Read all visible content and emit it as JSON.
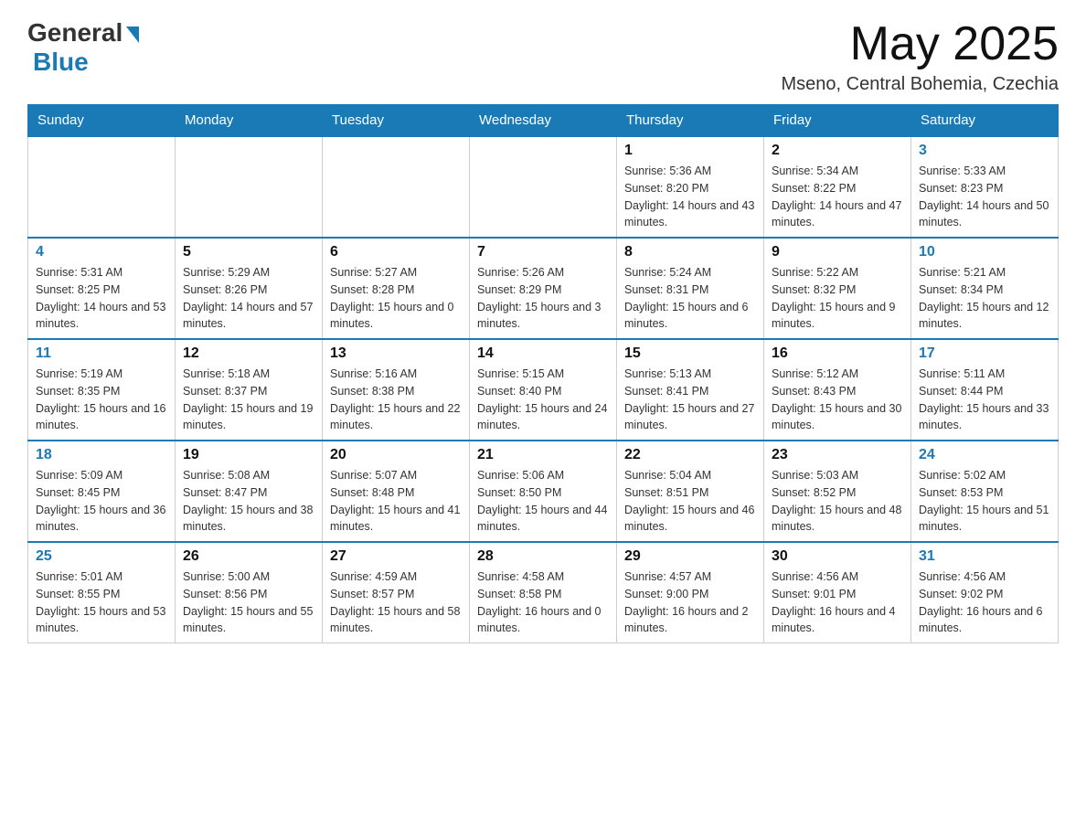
{
  "header": {
    "logo_general": "General",
    "logo_blue": "Blue",
    "month_title": "May 2025",
    "location": "Mseno, Central Bohemia, Czechia"
  },
  "weekdays": [
    "Sunday",
    "Monday",
    "Tuesday",
    "Wednesday",
    "Thursday",
    "Friday",
    "Saturday"
  ],
  "weeks": [
    [
      {
        "day": "",
        "info": ""
      },
      {
        "day": "",
        "info": ""
      },
      {
        "day": "",
        "info": ""
      },
      {
        "day": "",
        "info": ""
      },
      {
        "day": "1",
        "info": "Sunrise: 5:36 AM\nSunset: 8:20 PM\nDaylight: 14 hours and 43 minutes."
      },
      {
        "day": "2",
        "info": "Sunrise: 5:34 AM\nSunset: 8:22 PM\nDaylight: 14 hours and 47 minutes."
      },
      {
        "day": "3",
        "info": "Sunrise: 5:33 AM\nSunset: 8:23 PM\nDaylight: 14 hours and 50 minutes."
      }
    ],
    [
      {
        "day": "4",
        "info": "Sunrise: 5:31 AM\nSunset: 8:25 PM\nDaylight: 14 hours and 53 minutes."
      },
      {
        "day": "5",
        "info": "Sunrise: 5:29 AM\nSunset: 8:26 PM\nDaylight: 14 hours and 57 minutes."
      },
      {
        "day": "6",
        "info": "Sunrise: 5:27 AM\nSunset: 8:28 PM\nDaylight: 15 hours and 0 minutes."
      },
      {
        "day": "7",
        "info": "Sunrise: 5:26 AM\nSunset: 8:29 PM\nDaylight: 15 hours and 3 minutes."
      },
      {
        "day": "8",
        "info": "Sunrise: 5:24 AM\nSunset: 8:31 PM\nDaylight: 15 hours and 6 minutes."
      },
      {
        "day": "9",
        "info": "Sunrise: 5:22 AM\nSunset: 8:32 PM\nDaylight: 15 hours and 9 minutes."
      },
      {
        "day": "10",
        "info": "Sunrise: 5:21 AM\nSunset: 8:34 PM\nDaylight: 15 hours and 12 minutes."
      }
    ],
    [
      {
        "day": "11",
        "info": "Sunrise: 5:19 AM\nSunset: 8:35 PM\nDaylight: 15 hours and 16 minutes."
      },
      {
        "day": "12",
        "info": "Sunrise: 5:18 AM\nSunset: 8:37 PM\nDaylight: 15 hours and 19 minutes."
      },
      {
        "day": "13",
        "info": "Sunrise: 5:16 AM\nSunset: 8:38 PM\nDaylight: 15 hours and 22 minutes."
      },
      {
        "day": "14",
        "info": "Sunrise: 5:15 AM\nSunset: 8:40 PM\nDaylight: 15 hours and 24 minutes."
      },
      {
        "day": "15",
        "info": "Sunrise: 5:13 AM\nSunset: 8:41 PM\nDaylight: 15 hours and 27 minutes."
      },
      {
        "day": "16",
        "info": "Sunrise: 5:12 AM\nSunset: 8:43 PM\nDaylight: 15 hours and 30 minutes."
      },
      {
        "day": "17",
        "info": "Sunrise: 5:11 AM\nSunset: 8:44 PM\nDaylight: 15 hours and 33 minutes."
      }
    ],
    [
      {
        "day": "18",
        "info": "Sunrise: 5:09 AM\nSunset: 8:45 PM\nDaylight: 15 hours and 36 minutes."
      },
      {
        "day": "19",
        "info": "Sunrise: 5:08 AM\nSunset: 8:47 PM\nDaylight: 15 hours and 38 minutes."
      },
      {
        "day": "20",
        "info": "Sunrise: 5:07 AM\nSunset: 8:48 PM\nDaylight: 15 hours and 41 minutes."
      },
      {
        "day": "21",
        "info": "Sunrise: 5:06 AM\nSunset: 8:50 PM\nDaylight: 15 hours and 44 minutes."
      },
      {
        "day": "22",
        "info": "Sunrise: 5:04 AM\nSunset: 8:51 PM\nDaylight: 15 hours and 46 minutes."
      },
      {
        "day": "23",
        "info": "Sunrise: 5:03 AM\nSunset: 8:52 PM\nDaylight: 15 hours and 48 minutes."
      },
      {
        "day": "24",
        "info": "Sunrise: 5:02 AM\nSunset: 8:53 PM\nDaylight: 15 hours and 51 minutes."
      }
    ],
    [
      {
        "day": "25",
        "info": "Sunrise: 5:01 AM\nSunset: 8:55 PM\nDaylight: 15 hours and 53 minutes."
      },
      {
        "day": "26",
        "info": "Sunrise: 5:00 AM\nSunset: 8:56 PM\nDaylight: 15 hours and 55 minutes."
      },
      {
        "day": "27",
        "info": "Sunrise: 4:59 AM\nSunset: 8:57 PM\nDaylight: 15 hours and 58 minutes."
      },
      {
        "day": "28",
        "info": "Sunrise: 4:58 AM\nSunset: 8:58 PM\nDaylight: 16 hours and 0 minutes."
      },
      {
        "day": "29",
        "info": "Sunrise: 4:57 AM\nSunset: 9:00 PM\nDaylight: 16 hours and 2 minutes."
      },
      {
        "day": "30",
        "info": "Sunrise: 4:56 AM\nSunset: 9:01 PM\nDaylight: 16 hours and 4 minutes."
      },
      {
        "day": "31",
        "info": "Sunrise: 4:56 AM\nSunset: 9:02 PM\nDaylight: 16 hours and 6 minutes."
      }
    ]
  ]
}
